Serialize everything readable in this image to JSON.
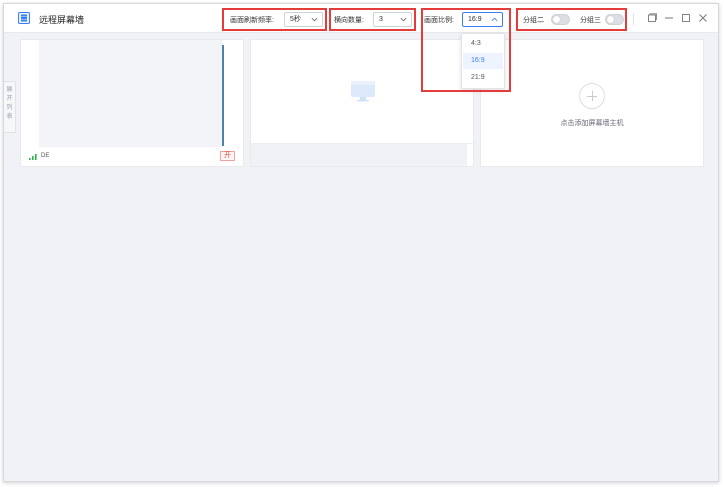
{
  "app": {
    "title": "远程屏幕墙"
  },
  "toolbar": {
    "refresh_label": "画面刷新频率:",
    "refresh_value": "5秒",
    "columns_label": "横向数量:",
    "columns_value": "3",
    "ratio_label": "画面比例:",
    "ratio_value": "16:9",
    "group2_label": "分组二",
    "group3_label": "分组三"
  },
  "ratio_options": [
    "4:3",
    "16:9",
    "21:9"
  ],
  "side_tab": {
    "label": "展开列表"
  },
  "tiles": [
    {
      "name": "DE",
      "status": "开"
    },
    {
      "name": "",
      "status": ""
    },
    {
      "add_label": "点击添加屏幕墙主机"
    }
  ],
  "colors": {
    "accent": "#3b7ff5",
    "highlight": "#e43b3b",
    "signal": "#2fb14c",
    "badge": "#e0483f"
  }
}
